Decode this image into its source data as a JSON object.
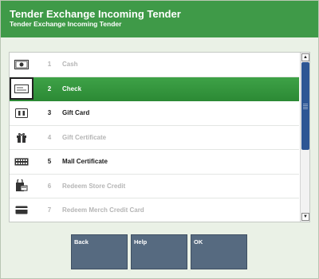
{
  "header": {
    "title": "Tender Exchange Incoming Tender",
    "subtitle": "Tender Exchange Incoming Tender"
  },
  "list": {
    "items": [
      {
        "number": "1",
        "label": "Cash",
        "icon": "cash-icon",
        "state": "disabled"
      },
      {
        "number": "2",
        "label": "Check",
        "icon": "check-icon",
        "state": "selected"
      },
      {
        "number": "3",
        "label": "Gift Card",
        "icon": "gift-card-icon",
        "state": "enabled"
      },
      {
        "number": "4",
        "label": "Gift Certificate",
        "icon": "gift-icon",
        "state": "disabled"
      },
      {
        "number": "5",
        "label": "Mall Certificate",
        "icon": "mall-certificate-icon",
        "state": "enabled"
      },
      {
        "number": "6",
        "label": "Redeem Store Credit",
        "icon": "store-credit-icon",
        "state": "disabled"
      },
      {
        "number": "7",
        "label": "Redeem Merch Credit Card",
        "icon": "merch-credit-card-icon",
        "state": "disabled"
      }
    ]
  },
  "buttons": {
    "back": "Back",
    "help": "Help",
    "ok": "OK"
  },
  "colors": {
    "header": "#3f9a48",
    "selected_row": "#3ea247",
    "button": "#566a80",
    "scroll_thumb": "#2d5694"
  }
}
